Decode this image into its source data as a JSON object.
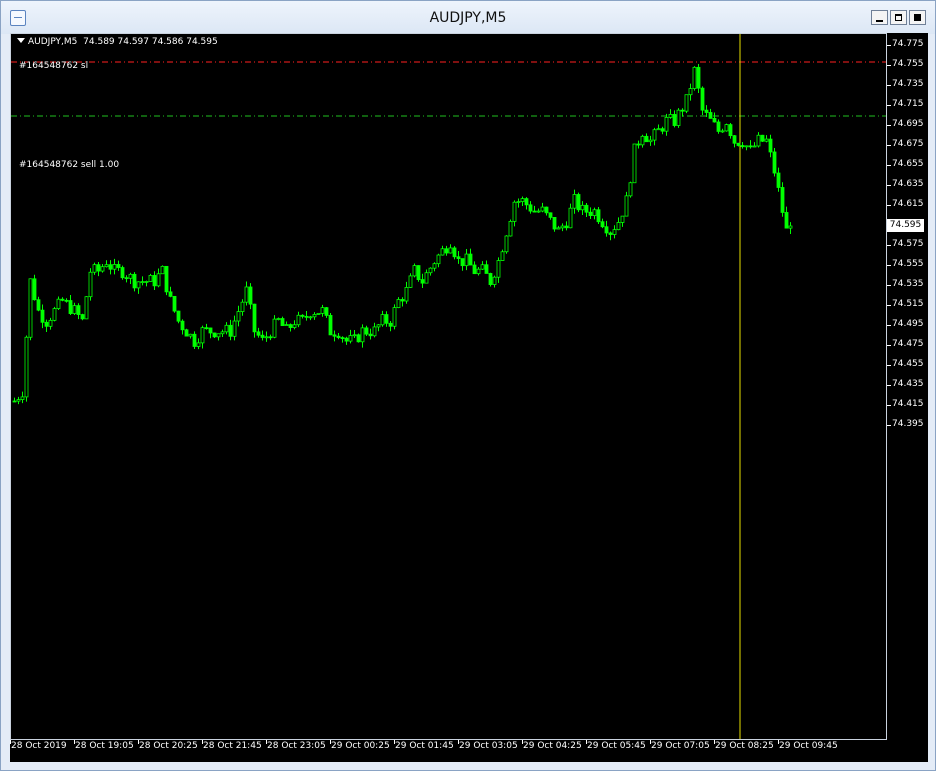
{
  "window": {
    "title": "AUDJPY,M5",
    "buttons": [
      "minimize-icon",
      "maximize-icon",
      "close-icon"
    ]
  },
  "chart_header": {
    "symbol": "AUDJPY,M5",
    "quote": "74.589 74.597 74.586 74.595"
  },
  "levels": [
    {
      "label": "#164548762 sl",
      "price": 74.759,
      "color": "#ff2020"
    },
    {
      "label": "#164548762 sell 1.00",
      "price": 74.705,
      "color": "#20c020"
    }
  ],
  "colors": {
    "background": "#000000",
    "candle": "#00ff00",
    "crosshair": "#e8e000",
    "text": "#ffffff"
  },
  "current_price": "74.595",
  "price_ticks": [
    "74.775",
    "74.755",
    "74.735",
    "74.715",
    "74.695",
    "74.675",
    "74.655",
    "74.635",
    "74.615",
    "74.595",
    "74.575",
    "74.555",
    "74.535",
    "74.515",
    "74.495",
    "74.475",
    "74.455",
    "74.435",
    "74.415",
    "74.395"
  ],
  "time_ticks": [
    "28 Oct 2019",
    "28 Oct 19:05",
    "28 Oct 20:25",
    "28 Oct 21:45",
    "28 Oct 23:05",
    "29 Oct 00:25",
    "29 Oct 01:45",
    "29 Oct 03:05",
    "29 Oct 04:25",
    "29 Oct 05:45",
    "29 Oct 07:05",
    "29 Oct 08:25",
    "29 Oct 09:45"
  ],
  "chart_data": {
    "type": "candlestick",
    "symbol": "AUDJPY",
    "timeframe": "M5",
    "y_range": [
      74.389,
      74.781
    ],
    "close_path": [
      {
        "bar": 0,
        "close": 74.42
      },
      {
        "bar": 2,
        "close": 74.43
      },
      {
        "bar": 4,
        "close": 74.54
      },
      {
        "bar": 6,
        "close": 74.51
      },
      {
        "bar": 8,
        "close": 74.5
      },
      {
        "bar": 10,
        "close": 74.51
      },
      {
        "bar": 12,
        "close": 74.52
      },
      {
        "bar": 15,
        "close": 74.51
      },
      {
        "bar": 17,
        "close": 74.5
      },
      {
        "bar": 19,
        "close": 74.55
      },
      {
        "bar": 21,
        "close": 74.55
      },
      {
        "bar": 23,
        "close": 74.56
      },
      {
        "bar": 25,
        "close": 74.55
      },
      {
        "bar": 27,
        "close": 74.55
      },
      {
        "bar": 30,
        "close": 74.54
      },
      {
        "bar": 32,
        "close": 74.54
      },
      {
        "bar": 35,
        "close": 74.54
      },
      {
        "bar": 37,
        "close": 74.55
      },
      {
        "bar": 39,
        "close": 74.52
      },
      {
        "bar": 41,
        "close": 74.5
      },
      {
        "bar": 43,
        "close": 74.49
      },
      {
        "bar": 45,
        "close": 74.48
      },
      {
        "bar": 47,
        "close": 74.49
      },
      {
        "bar": 50,
        "close": 74.49
      },
      {
        "bar": 52,
        "close": 74.49
      },
      {
        "bar": 54,
        "close": 74.49
      },
      {
        "bar": 56,
        "close": 74.51
      },
      {
        "bar": 58,
        "close": 74.53
      },
      {
        "bar": 60,
        "close": 74.49
      },
      {
        "bar": 62,
        "close": 74.48
      },
      {
        "bar": 64,
        "close": 74.49
      },
      {
        "bar": 66,
        "close": 74.5
      },
      {
        "bar": 68,
        "close": 74.49
      },
      {
        "bar": 70,
        "close": 74.5
      },
      {
        "bar": 72,
        "close": 74.5
      },
      {
        "bar": 74,
        "close": 74.51
      },
      {
        "bar": 77,
        "close": 74.51
      },
      {
        "bar": 79,
        "close": 74.49
      },
      {
        "bar": 81,
        "close": 74.49
      },
      {
        "bar": 83,
        "close": 74.48
      },
      {
        "bar": 85,
        "close": 74.48
      },
      {
        "bar": 87,
        "close": 74.49
      },
      {
        "bar": 90,
        "close": 74.49
      },
      {
        "bar": 92,
        "close": 74.5
      },
      {
        "bar": 94,
        "close": 74.5
      },
      {
        "bar": 96,
        "close": 74.52
      },
      {
        "bar": 98,
        "close": 74.53
      },
      {
        "bar": 100,
        "close": 74.55
      },
      {
        "bar": 102,
        "close": 74.54
      },
      {
        "bar": 105,
        "close": 74.56
      },
      {
        "bar": 107,
        "close": 74.57
      },
      {
        "bar": 109,
        "close": 74.58
      },
      {
        "bar": 111,
        "close": 74.56
      },
      {
        "bar": 113,
        "close": 74.56
      },
      {
        "bar": 115,
        "close": 74.55
      },
      {
        "bar": 117,
        "close": 74.55
      },
      {
        "bar": 119,
        "close": 74.54
      },
      {
        "bar": 121,
        "close": 74.56
      },
      {
        "bar": 123,
        "close": 74.59
      },
      {
        "bar": 125,
        "close": 74.62
      },
      {
        "bar": 127,
        "close": 74.62
      },
      {
        "bar": 130,
        "close": 74.61
      },
      {
        "bar": 132,
        "close": 74.61
      },
      {
        "bar": 134,
        "close": 74.6
      },
      {
        "bar": 136,
        "close": 74.59
      },
      {
        "bar": 138,
        "close": 74.6
      },
      {
        "bar": 140,
        "close": 74.62
      },
      {
        "bar": 142,
        "close": 74.61
      },
      {
        "bar": 145,
        "close": 74.61
      },
      {
        "bar": 147,
        "close": 74.6
      },
      {
        "bar": 149,
        "close": 74.59
      },
      {
        "bar": 151,
        "close": 74.6
      },
      {
        "bar": 153,
        "close": 74.62
      },
      {
        "bar": 155,
        "close": 74.67
      },
      {
        "bar": 157,
        "close": 74.69
      },
      {
        "bar": 159,
        "close": 74.68
      },
      {
        "bar": 161,
        "close": 74.69
      },
      {
        "bar": 163,
        "close": 74.7
      },
      {
        "bar": 165,
        "close": 74.7
      },
      {
        "bar": 168,
        "close": 74.72
      },
      {
        "bar": 170,
        "close": 74.75
      },
      {
        "bar": 172,
        "close": 74.71
      },
      {
        "bar": 174,
        "close": 74.7
      },
      {
        "bar": 176,
        "close": 74.69
      },
      {
        "bar": 178,
        "close": 74.7
      },
      {
        "bar": 180,
        "close": 74.68
      },
      {
        "bar": 182,
        "close": 74.68
      },
      {
        "bar": 184,
        "close": 74.67
      },
      {
        "bar": 186,
        "close": 74.68
      },
      {
        "bar": 188,
        "close": 74.68
      },
      {
        "bar": 190,
        "close": 74.65
      },
      {
        "bar": 192,
        "close": 74.61
      },
      {
        "bar": 193,
        "close": 74.59
      },
      {
        "bar": 194,
        "close": 74.595
      }
    ]
  }
}
